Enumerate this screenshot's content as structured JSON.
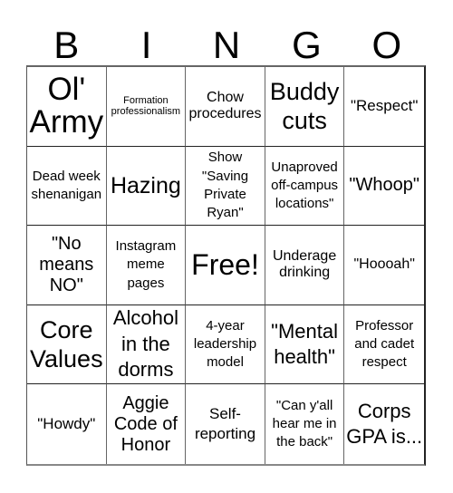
{
  "header": {
    "letters": [
      "B",
      "I",
      "N",
      "G",
      "O"
    ]
  },
  "cells": [
    "Ol' Army",
    "Formation professionalism",
    "Chow procedures",
    "Buddy cuts",
    "\"Respect\"",
    "Dead week shenanigan",
    "Hazing",
    "Show \"Saving Private Ryan\"",
    "Unaproved off-campus locations\"",
    "\"Whoop\"",
    "\"No means NO\"",
    "Instagram meme pages",
    "Free!",
    "Underage drinking",
    "\"Hoooah\"",
    "Core Values",
    "Alcohol in the dorms",
    "4-year leadership model",
    "\"Mental health\"",
    "Professor and cadet respect",
    "\"Howdy\"",
    "Aggie Code of Honor",
    "Self-reporting",
    "\"Can y'all hear me in the back\"",
    "Corps GPA is..."
  ]
}
